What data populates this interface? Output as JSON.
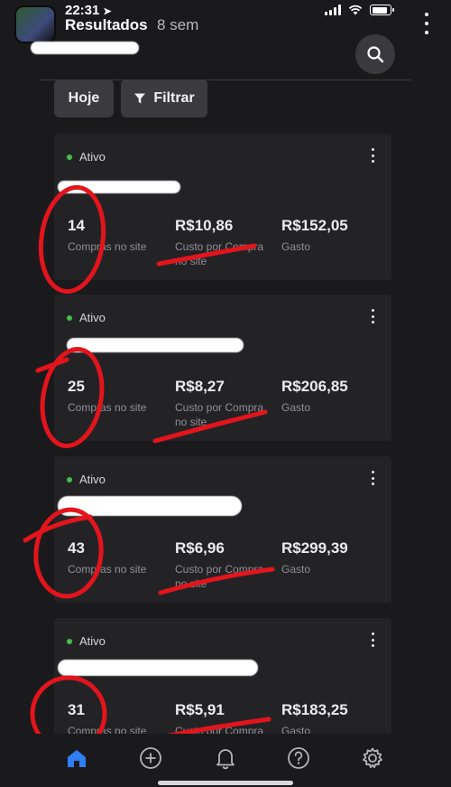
{
  "status_bar": {
    "time": "22:31",
    "location_arrow": "➤"
  },
  "header": {
    "title": "Resultados",
    "subtitle": "8 sem"
  },
  "filters": {
    "today_label": "Hoje",
    "filter_label": "Filtrar"
  },
  "cards": [
    {
      "status": "Ativo",
      "purchases": "14",
      "purchases_label": "Compras no site",
      "cost": "R$10,86",
      "cost_label": "Custo por Compra no site",
      "spent": "R$152,05",
      "spent_label": "Gasto"
    },
    {
      "status": "Ativo",
      "purchases": "25",
      "purchases_label": "Compras no site",
      "cost": "R$8,27",
      "cost_label": "Custo por Compra no site",
      "spent": "R$206,85",
      "spent_label": "Gasto"
    },
    {
      "status": "Ativo",
      "purchases": "43",
      "purchases_label": "Compras no site",
      "cost": "R$6,96",
      "cost_label": "Custo por Compra no site",
      "spent": "R$299,39",
      "spent_label": "Gasto"
    },
    {
      "status": "Ativo",
      "purchases": "31",
      "purchases_label": "Compras no site",
      "cost": "R$5,91",
      "cost_label": "Custo por Compra",
      "spent": "R$183,25",
      "spent_label": "Gasto"
    }
  ],
  "nav": {
    "active_color": "#2f7ef6",
    "icons": [
      "home-icon",
      "plus-circle-icon",
      "bell-icon",
      "help-icon",
      "settings-icon"
    ]
  },
  "colors": {
    "background": "#1a1a1c",
    "card": "#232326",
    "status_dot": "#45bd4a",
    "annotation": "#e3141c"
  }
}
